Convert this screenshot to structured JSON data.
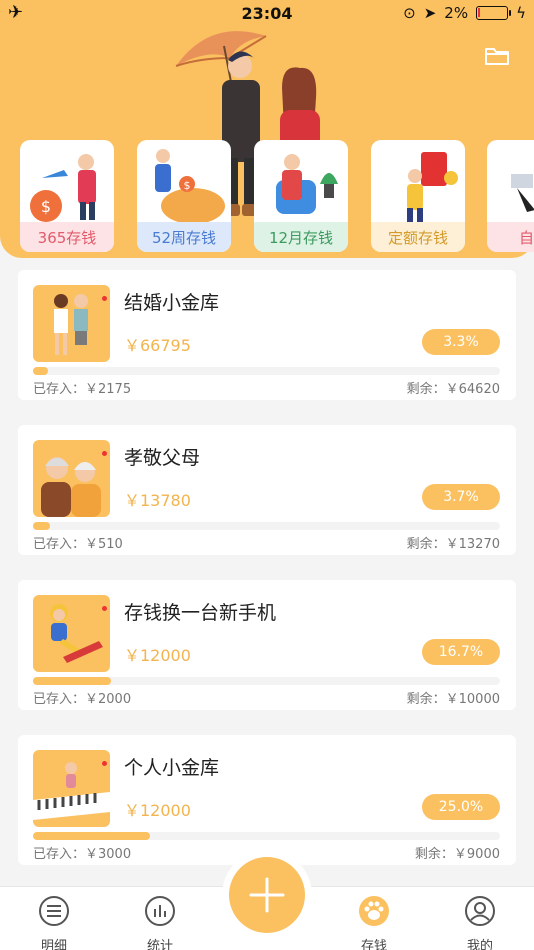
{
  "status": {
    "time": "23:04",
    "battery": "2%"
  },
  "colors": {
    "accent": "#fbc160",
    "amount": "#f3b44e"
  },
  "plans": [
    {
      "label": "365存钱",
      "bg": "#fde3e6",
      "color": "#e25a6a"
    },
    {
      "label": "52周存钱",
      "bg": "#dde9fb",
      "color": "#4a7bd0"
    },
    {
      "label": "12月存钱",
      "bg": "#def3e6",
      "color": "#3d9b5f"
    },
    {
      "label": "定额存钱",
      "bg": "#fdf0d6",
      "color": "#d49a2a"
    },
    {
      "label": "自由",
      "bg": "#fde3e6",
      "color": "#e25a6a"
    }
  ],
  "goals": [
    {
      "name": "结婚小金库",
      "amount": "￥66795",
      "percent": "3.3%",
      "progress": 0.033,
      "saved": "已存入：￥2175",
      "remaining": "剩余：￥64620"
    },
    {
      "name": "孝敬父母",
      "amount": "￥13780",
      "percent": "3.7%",
      "progress": 0.037,
      "saved": "已存入：￥510",
      "remaining": "剩余：￥13270"
    },
    {
      "name": "存钱换一台新手机",
      "amount": "￥12000",
      "percent": "16.7%",
      "progress": 0.167,
      "saved": "已存入：￥2000",
      "remaining": "剩余：￥10000"
    },
    {
      "name": "个人小金库",
      "amount": "￥12000",
      "percent": "25.0%",
      "progress": 0.25,
      "saved": "已存入：￥3000",
      "remaining": "剩余：￥9000"
    }
  ],
  "tabs": [
    {
      "label": "明细",
      "icon": "list-icon"
    },
    {
      "label": "统计",
      "icon": "chart-icon"
    },
    {
      "label": "存钱",
      "icon": "paw-icon"
    },
    {
      "label": "我的",
      "icon": "user-icon"
    }
  ],
  "add_icon": "plus-icon"
}
